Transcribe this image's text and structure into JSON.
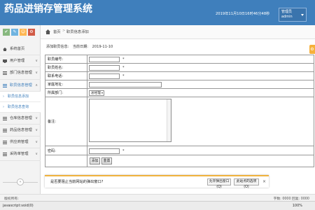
{
  "header": {
    "app_title": "药品进销存管理系统",
    "datetime": "2019年11月10日16时46分48秒",
    "user_role": "管理员",
    "username": "admin",
    "bg_color": "#3f7fbc"
  },
  "sidebar": {
    "shortcut_icons": [
      "check-icon",
      "pencil-icon",
      "user-icon",
      "gear-icon"
    ],
    "items": [
      {
        "label": "系统首页",
        "icon": "home-icon"
      },
      {
        "label": "用户管理",
        "icon": "monitor-icon"
      },
      {
        "label": "部门信息管理",
        "icon": "list-icon"
      },
      {
        "label": "职员信息管理",
        "icon": "list-icon",
        "open": true
      },
      {
        "label": "仓库信息管理",
        "icon": "list-icon"
      },
      {
        "label": "药品信息管理",
        "icon": "list-icon"
      },
      {
        "label": "供应商管理",
        "icon": "list-icon"
      },
      {
        "label": "采购单管理",
        "icon": "list-icon"
      }
    ],
    "subitems": [
      {
        "label": "职员信息添加"
      },
      {
        "label": "职员信息查询"
      }
    ]
  },
  "breadcrumb": {
    "home": "首页",
    "separator": ">",
    "current": "职员信息添加"
  },
  "form": {
    "info_label": "添加职员信息:",
    "date_label": "当前日期:",
    "date_value": "2019-11-10",
    "fields": {
      "employee_no": "职员编号:",
      "employee_name": "职员姓名:",
      "contact_phone": "联系电话:",
      "home_address": "家庭地址:",
      "department": "所属部门:",
      "remark": "备注:",
      "password": "密码:"
    },
    "required_mark": "*",
    "department_selected": "总经理",
    "submit_label": "添加",
    "reset_label": "重置"
  },
  "footer": {
    "version": "版权所有:",
    "counter": "字数: 0000  回复: 0000"
  },
  "notification": {
    "text": "是否要阻止当前网站的弹出窗口?",
    "allow_label": "允许弹出窗口(Q)",
    "options_label": "此站点的选项(O)",
    "close": "×"
  },
  "statusbar": {
    "text": "javascript:void(0)",
    "zoom": "100%"
  }
}
